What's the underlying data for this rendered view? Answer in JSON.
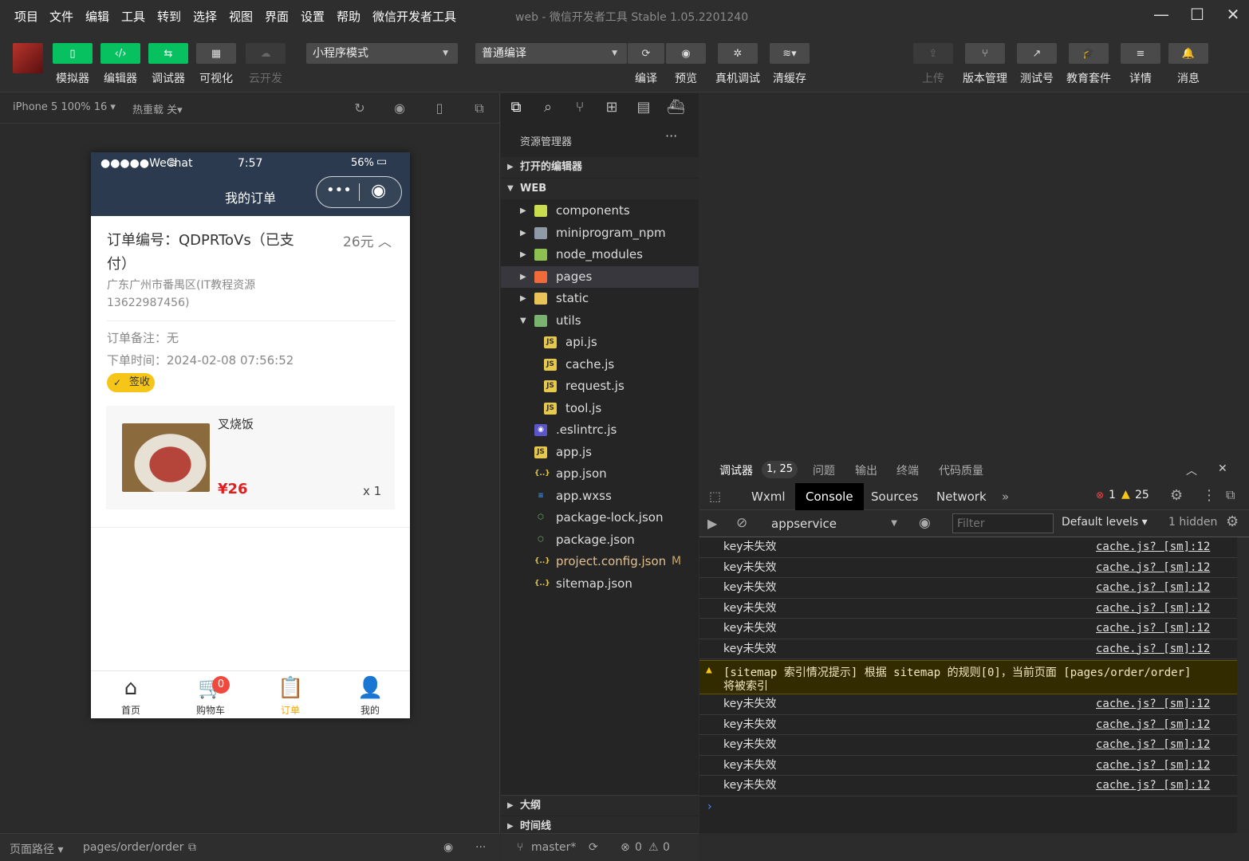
{
  "menu": [
    "项目",
    "文件",
    "编辑",
    "工具",
    "转到",
    "选择",
    "视图",
    "界面",
    "设置",
    "帮助",
    "微信开发者工具"
  ],
  "window_title": "web - 微信开发者工具 Stable 1.05.2201240",
  "toolbar": {
    "left_buttons": [
      "模拟器",
      "编辑器",
      "调试器",
      "可视化",
      "云开发"
    ],
    "mode_dropdown": "小程序模式",
    "compile_dropdown": "普通编译",
    "mid_buttons": [
      "编译",
      "预览",
      "真机调试",
      "清缓存"
    ],
    "right_buttons": [
      "上传",
      "版本管理",
      "测试号",
      "教育套件",
      "详情",
      "消息"
    ]
  },
  "simulator": {
    "device": "iPhone 5 100% 16",
    "hot_reload": "热重载 关",
    "phone": {
      "carrier": "●●●●●WeChat",
      "time": "7:57",
      "battery": "56%",
      "nav_title": "我的订单",
      "order_no": "订单编号：QDPRToVs（已支付）",
      "price": "26元",
      "address": "广东广州市番禺区(IT教程资源 13622987456)",
      "remark": "订单备注：无",
      "order_time": "下单时间：2024-02-08 07:56:52",
      "status_badge": "签收",
      "item_name": "叉烧饭",
      "item_price": "¥26",
      "item_qty": "x 1",
      "tabs": [
        "首页",
        "购物车",
        "订单",
        "我的"
      ],
      "cart_count": "0"
    }
  },
  "left_status": {
    "path_label": "页面路径",
    "path": "pages/order/order"
  },
  "explorer": {
    "title": "资源管理器",
    "open_editors": "打开的编辑器",
    "root": "WEB",
    "tree": [
      {
        "name": "components",
        "type": "folder"
      },
      {
        "name": "miniprogram_npm",
        "type": "folder"
      },
      {
        "name": "node_modules",
        "type": "folder"
      },
      {
        "name": "pages",
        "type": "folder"
      },
      {
        "name": "static",
        "type": "folder"
      },
      {
        "name": "utils",
        "type": "folder"
      },
      {
        "name": "api.js",
        "type": "js"
      },
      {
        "name": "cache.js",
        "type": "js"
      },
      {
        "name": "request.js",
        "type": "js"
      },
      {
        "name": "tool.js",
        "type": "js"
      },
      {
        "name": ".eslintrc.js",
        "type": "eslint"
      },
      {
        "name": "app.js",
        "type": "js"
      },
      {
        "name": "app.json",
        "type": "json"
      },
      {
        "name": "app.wxss",
        "type": "wxss"
      },
      {
        "name": "package-lock.json",
        "type": "npm"
      },
      {
        "name": "package.json",
        "type": "npm"
      },
      {
        "name": "project.config.json",
        "type": "json",
        "modified": "M"
      },
      {
        "name": "sitemap.json",
        "type": "json"
      }
    ],
    "outline": "大纲",
    "timeline": "时间线",
    "branch": "master*",
    "errors": "0",
    "warnings": "0"
  },
  "devtools": {
    "top_tabs": [
      "调试器",
      "问题",
      "输出",
      "终端",
      "代码质量"
    ],
    "top_badge": "1, 25",
    "tabs": [
      "Wxml",
      "Console",
      "Sources",
      "Network"
    ],
    "active_tab": "Console",
    "error_count": "1",
    "warning_count": "25",
    "context": "appservice",
    "filter_placeholder": "Filter",
    "levels": "Default levels",
    "hidden": "1 hidden",
    "log_message": "key未失效",
    "log_source": "cache.js? [sm]:12",
    "warning_text_1": "[sitemap 索引情况提示] 根据 sitemap 的规则[0]，当前页面 [pages/order/order]",
    "warning_text_2": "将被索引"
  },
  "colors": {
    "accent_green": "#07c160",
    "nav_bg": "#2b3a4e",
    "price_red": "#e02020",
    "badge_yellow": "#f5c518"
  }
}
